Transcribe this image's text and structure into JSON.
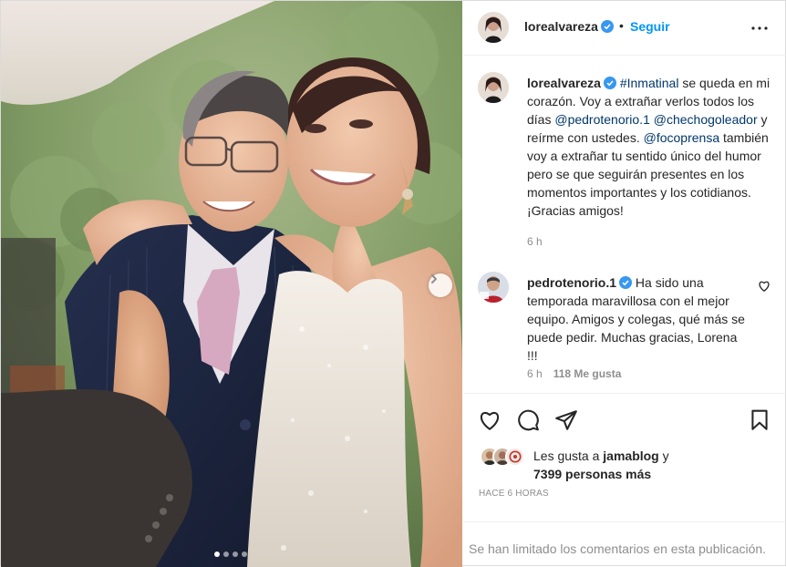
{
  "post": {
    "author": "lorealvareza",
    "follow_label": "Seguir",
    "header_separator": "•",
    "more_icon": "more-icon",
    "carousel": {
      "slide_count": 4,
      "active_slide": 1
    }
  },
  "caption": {
    "author": "lorealvareza",
    "hashtag": "#Inmatinal",
    "text_1": " se queda en mi corazón. Voy a extrañar verlos todos los días ",
    "mention_1": "@pedrotenorio.1",
    "text_2": " ",
    "mention_2": "@chechogoleador",
    "text_3": " y reírme con ustedes. ",
    "mention_3": "@focoprensa",
    "text_4": " también voy a extrañar tu sentido único del humor pero se que seguirán presentes en los momentos importantes y los cotidianos. ¡Gracias amigos!",
    "time": "6 h"
  },
  "reply": {
    "author": "pedrotenorio.1",
    "text": " Ha sido una temporada maravillosa con el mejor equipo. Amigos y colegas, qué más se puede pedir. Muchas gracias, Lorena !!!",
    "time": "6 h",
    "likes": "118 Me gusta"
  },
  "likes": {
    "prefix": "Les gusta a ",
    "user": "jamablog",
    "middle": " y",
    "count": "7399 personas más"
  },
  "posted_ago": "HACE 6 HORAS",
  "comments_limited": "Se han limitado los comentarios en esta publicación.",
  "colors": {
    "link_blue": "#0095f6",
    "mention": "#00376b",
    "muted": "#8e8e8e",
    "verified": "#3897f0"
  }
}
